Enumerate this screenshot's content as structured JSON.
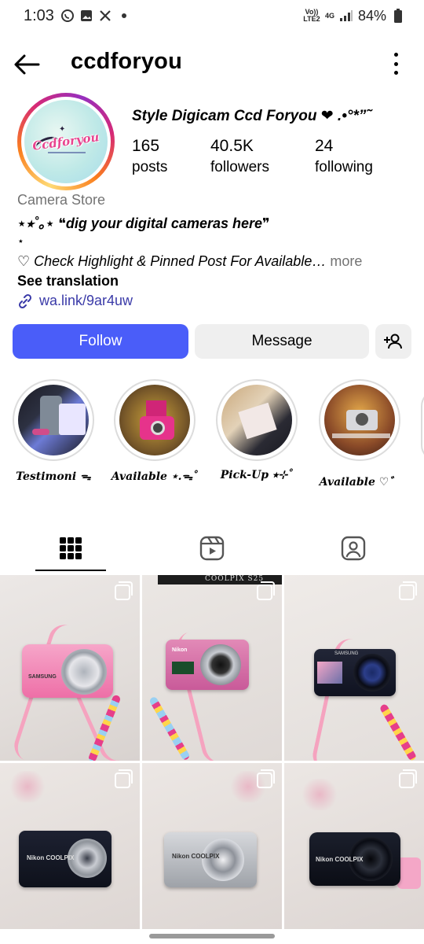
{
  "status_bar": {
    "time": "1:03",
    "network_label": "Vo)) LTE2",
    "network_type": "4G",
    "battery": "84%"
  },
  "header": {
    "username": "ccdforyou"
  },
  "avatar": {
    "logo_text": "Ccdforyou"
  },
  "profile": {
    "display_name": "Style Digicam Ccd Foryou ❤︎ .•°*”˜",
    "stats": [
      {
        "value": "165",
        "label": "posts"
      },
      {
        "value": "40.5K",
        "label": "followers"
      },
      {
        "value": "24",
        "label": "following"
      }
    ],
    "category": "Camera Store",
    "bio_line1": "⋆⭒˚｡⋆ ❝dig your digital cameras here❞",
    "bio_line2": "⋆",
    "bio_line3": "♡ Check Highlight & Pinned Post For Available…",
    "bio_more": " more",
    "see_translation": "See translation",
    "link": "wa.link/9ar4uw"
  },
  "buttons": {
    "follow": "Follow",
    "message": "Message"
  },
  "highlights": [
    {
      "label": "Testimoni ᯓ"
    },
    {
      "label": "Available ⋆.ᯓ˚"
    },
    {
      "label": "Pick-Up ⭒⊹˚"
    },
    {
      "label": "Available ♡゛"
    }
  ],
  "tabs": [
    "grid",
    "reels",
    "tagged"
  ],
  "grid": {
    "posts": [
      {
        "brand": "SAMSUNG",
        "color": "pink"
      },
      {
        "brand": "Nikon",
        "color": "pink"
      },
      {
        "brand": "SAMSUNG",
        "color": "black"
      },
      {
        "brand": "Nikon COOLPIX",
        "color": "black"
      },
      {
        "brand": "Nikon COOLPIX",
        "color": "silver"
      },
      {
        "brand": "Nikon COOLPIX",
        "color": "black"
      }
    ],
    "banner_text": "COOLPIX S25"
  }
}
